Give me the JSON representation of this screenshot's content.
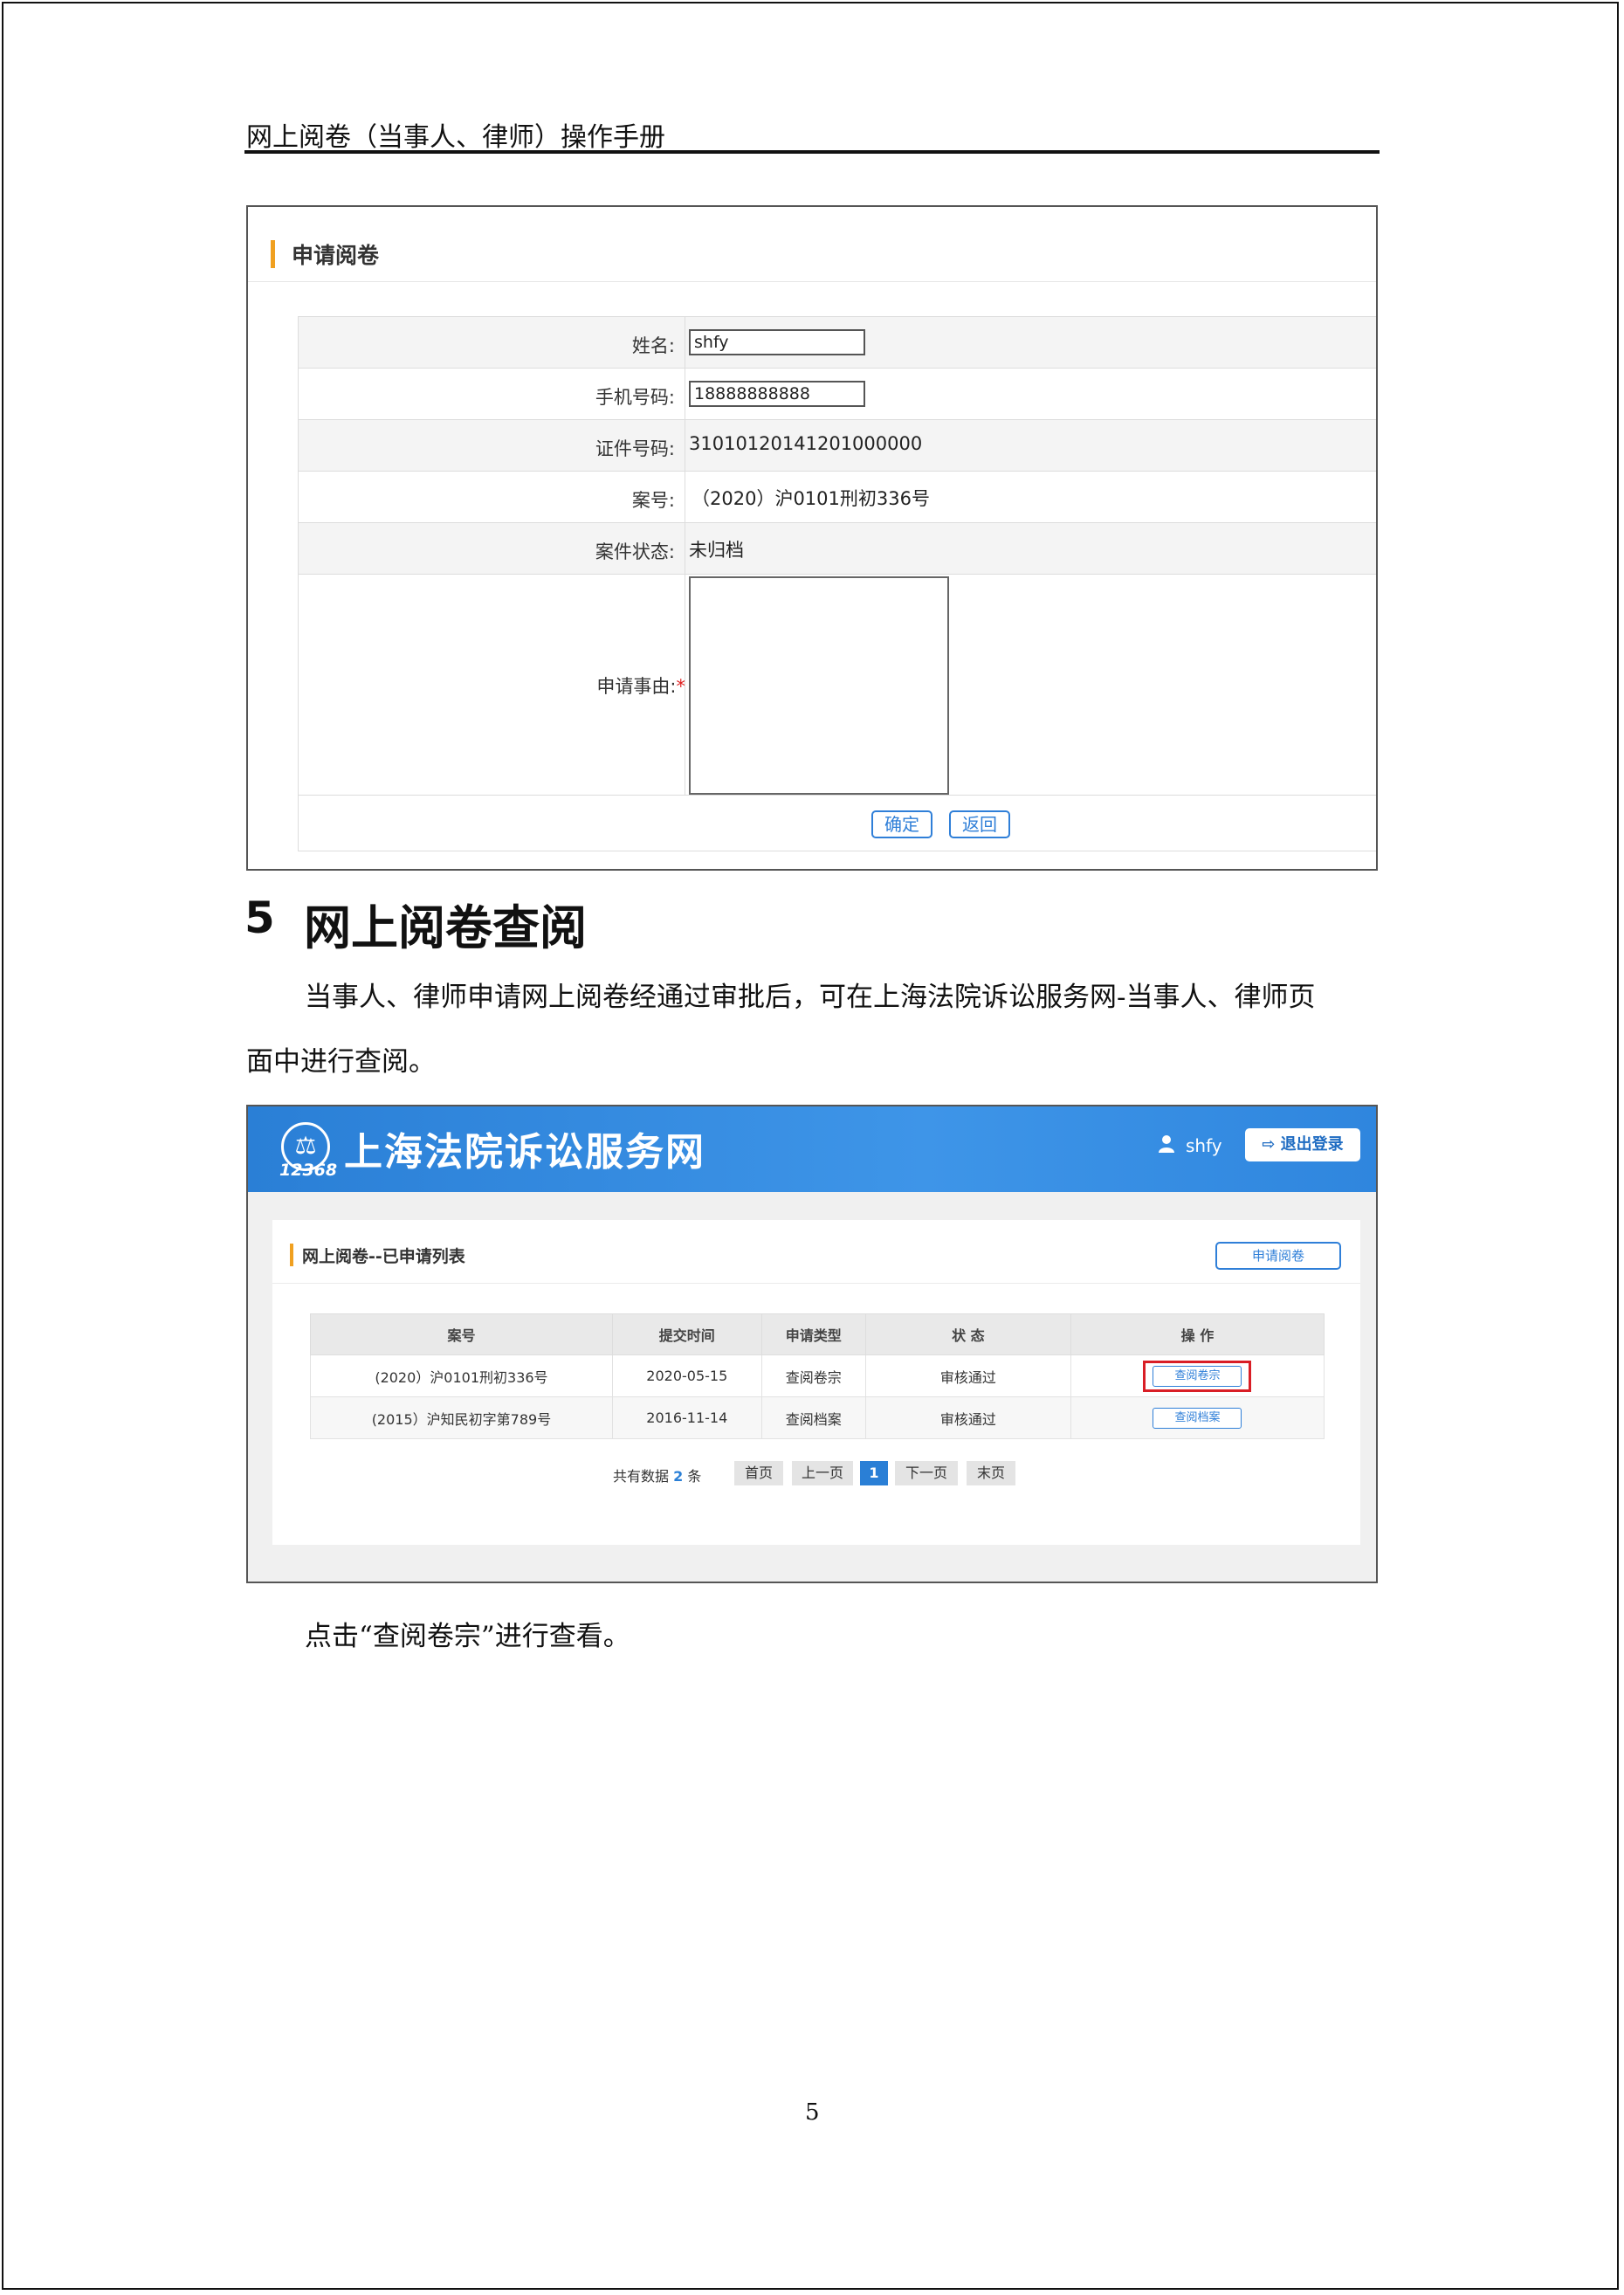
{
  "header": {
    "title": "网上阅卷（当事人、律师）操作手册"
  },
  "shot1": {
    "panel_title": "申请阅卷",
    "rows": [
      {
        "label": "姓名:",
        "value": "shfy"
      },
      {
        "label": "手机号码:",
        "value": "18888888888"
      },
      {
        "label": "证件号码:",
        "value": "310101201412010000​00"
      },
      {
        "label": "案号:",
        "value": "（2020）沪0101刑初336号"
      },
      {
        "label": "案件状态:",
        "value": "未归档"
      },
      {
        "label": "申请事由:",
        "required_mark": "*"
      }
    ],
    "confirm_label": "确定",
    "back_label": "返回"
  },
  "section": {
    "number": "5",
    "title": "网上阅卷查阅"
  },
  "para1_line1": "当事人、律师申请网上阅卷经通过审批后，可在上海法院诉讼服务网-当事人、律师页",
  "para1_line2": "面中进行查阅。",
  "shot2": {
    "logo_symbol": "⚖",
    "logo_number": "12368",
    "brand": "上海法院诉讼服务网",
    "user_icon": "user-icon",
    "username": "shfy",
    "logout_label": "退出登录",
    "panel_title": "网上阅卷--已申请列表",
    "apply_button": "申请阅卷",
    "columns": [
      "案号",
      "提交时间",
      "申请类型",
      "状 态",
      "操 作"
    ],
    "rows": [
      {
        "case_no": "(2020）沪0101刑初336号",
        "time": "2020-05-15",
        "type": "查阅卷宗",
        "status": "审核通过",
        "action": "查阅卷宗"
      },
      {
        "case_no": "(2015）沪知民初字第789号",
        "time": "2016-11-14",
        "type": "查阅档案",
        "status": "审核通过",
        "action": "查阅档案"
      }
    ],
    "pager": {
      "total_prefix": "共有数据",
      "total_count": "2",
      "total_suffix": "条",
      "first": "首页",
      "prev": "上一页",
      "current": "1",
      "next": "下一页",
      "last": "末页"
    }
  },
  "para2": "点击“查阅卷宗”进行查看。",
  "page_number": "5"
}
